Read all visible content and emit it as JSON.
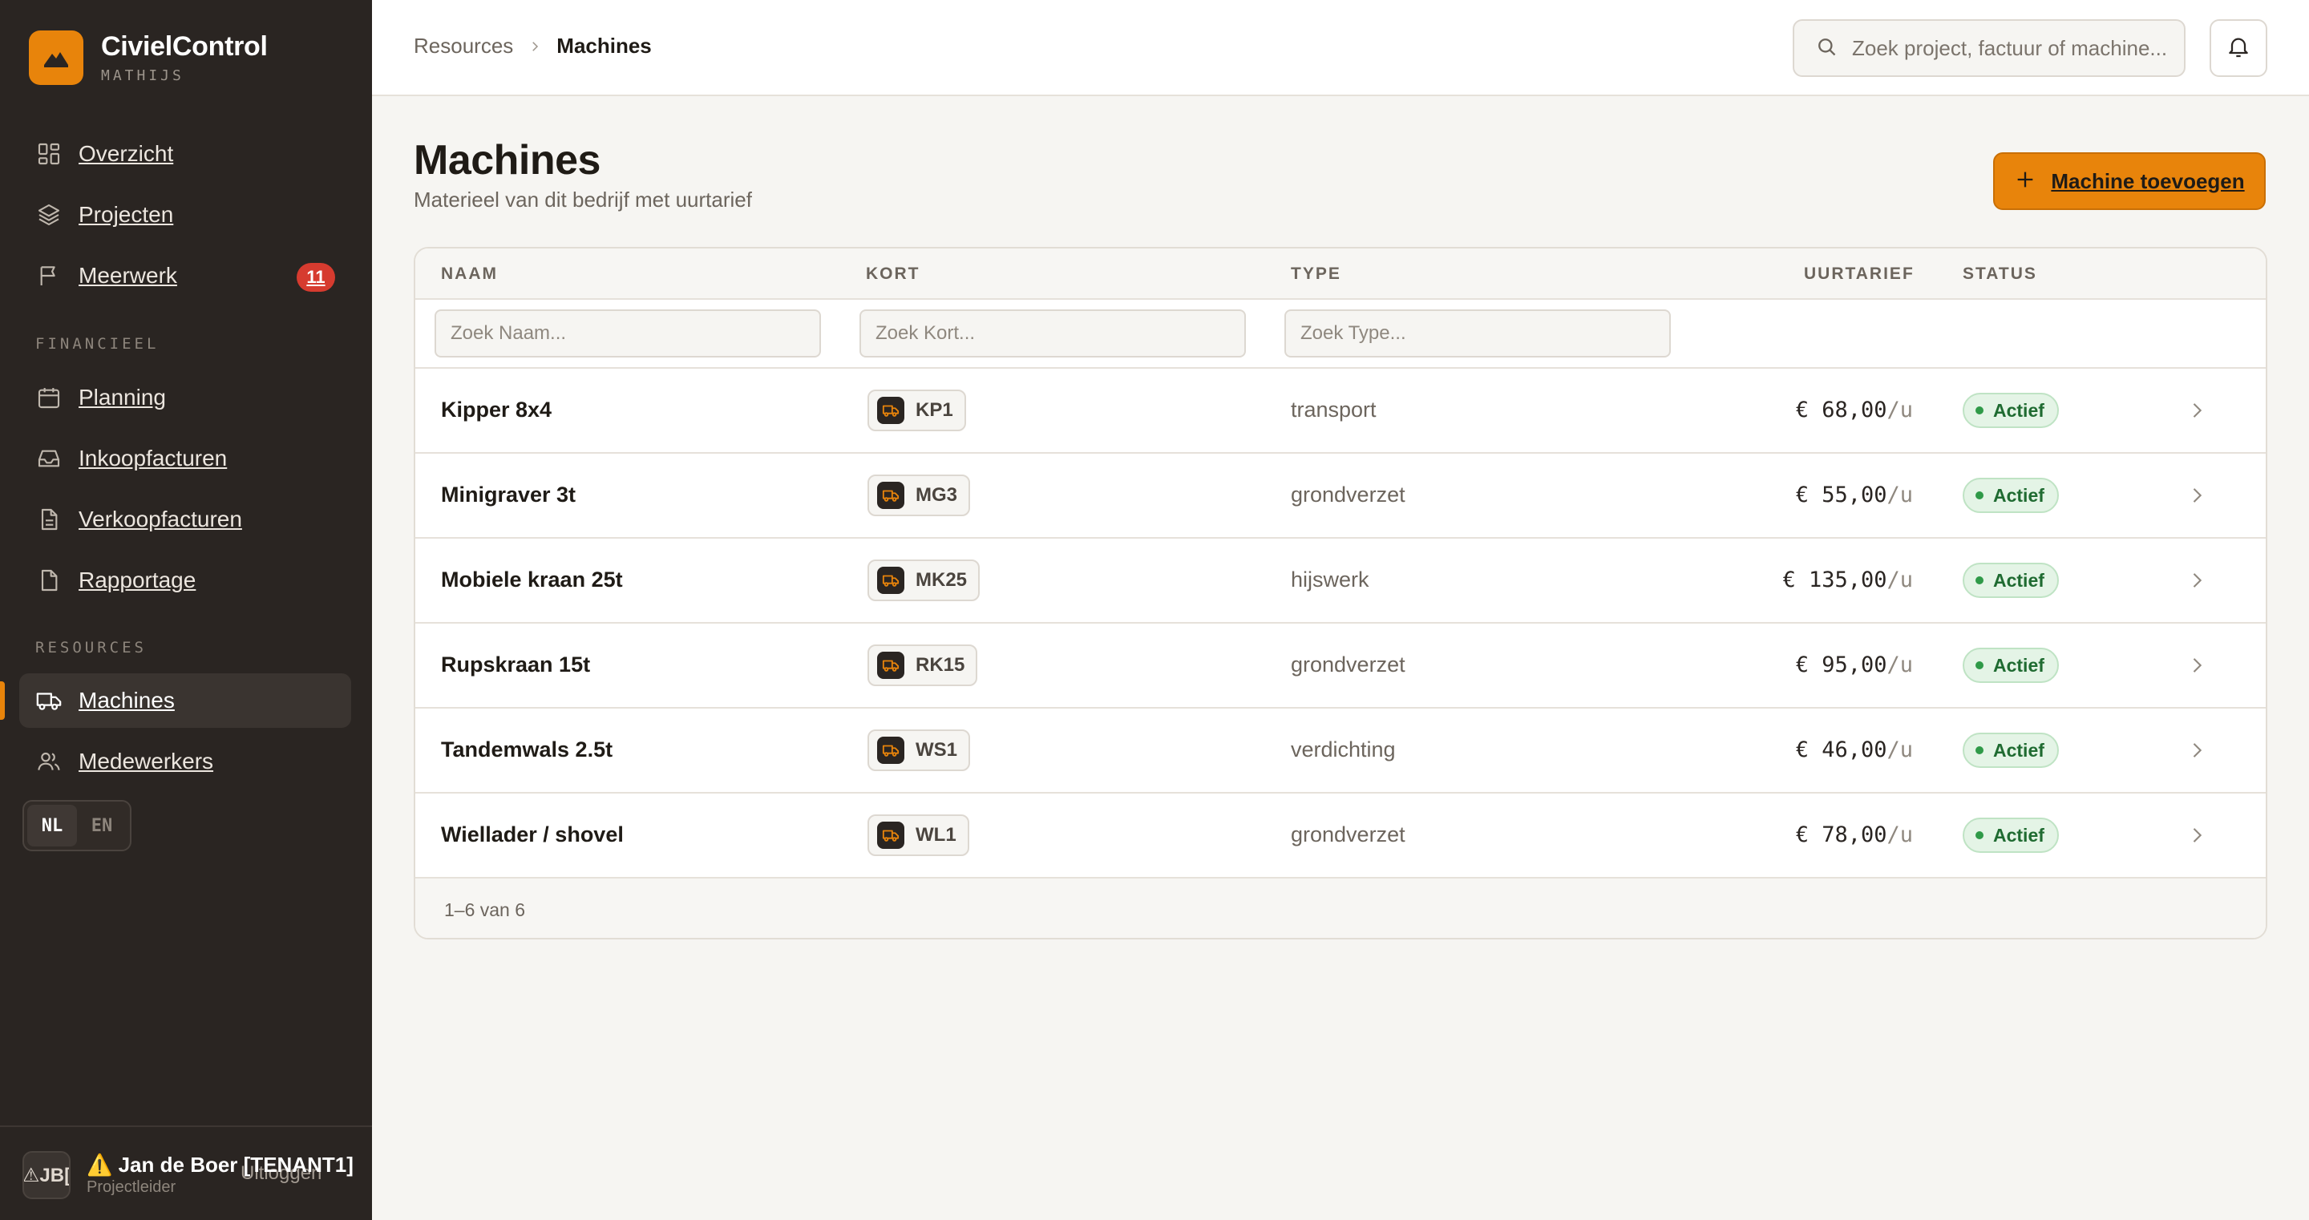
{
  "brand": {
    "name": "CivielControl",
    "tenant": "MATHIJS"
  },
  "nav": {
    "main": [
      {
        "label": "Overzicht",
        "icon": "dashboard-icon"
      },
      {
        "label": "Projecten",
        "icon": "layers-icon"
      },
      {
        "label": "Meerwerk",
        "icon": "flag-icon",
        "badge": "11"
      }
    ],
    "financial_heading": "FINANCIEEL",
    "financial": [
      {
        "label": "Planning",
        "icon": "calendar-icon"
      },
      {
        "label": "Inkoopfacturen",
        "icon": "inbox-icon"
      },
      {
        "label": "Verkoopfacturen",
        "icon": "document-icon"
      },
      {
        "label": "Rapportage",
        "icon": "file-icon"
      }
    ],
    "resources_heading": "RESOURCES",
    "resources": [
      {
        "label": "Machines",
        "icon": "truck-icon",
        "active": true
      },
      {
        "label": "Medewerkers",
        "icon": "users-icon"
      }
    ]
  },
  "lang": {
    "nl": "NL",
    "en": "EN",
    "selected": "NL"
  },
  "user": {
    "avatar": "⚠JB[",
    "name": "⚠️ Jan de Boer [TENANT1]",
    "role": "Projectleider",
    "logout": "Uitloggen"
  },
  "topbar": {
    "breadcrumb_parent": "Resources",
    "breadcrumb_current": "Machines",
    "search_placeholder": "Zoek project, factuur of machine..."
  },
  "page": {
    "title": "Machines",
    "subtitle": "Materieel van dit bedrijf met uurtarief",
    "add_button": "Machine toevoegen"
  },
  "table": {
    "columns": {
      "name": "NAAM",
      "short": "KORT",
      "type": "TYPE",
      "rate": "UURTARIEF",
      "status": "STATUS"
    },
    "filters": {
      "name": "Zoek Naam...",
      "short": "Zoek Kort...",
      "type": "Zoek Type..."
    },
    "rows": [
      {
        "name": "Kipper 8x4",
        "short": "KP1",
        "type": "transport",
        "rate": "€ 68,00",
        "unit": "/u",
        "status": "Actief"
      },
      {
        "name": "Minigraver 3t",
        "short": "MG3",
        "type": "grondverzet",
        "rate": "€ 55,00",
        "unit": "/u",
        "status": "Actief"
      },
      {
        "name": "Mobiele kraan 25t",
        "short": "MK25",
        "type": "hijswerk",
        "rate": "€ 135,00",
        "unit": "/u",
        "status": "Actief"
      },
      {
        "name": "Rupskraan 15t",
        "short": "RK15",
        "type": "grondverzet",
        "rate": "€ 95,00",
        "unit": "/u",
        "status": "Actief"
      },
      {
        "name": "Tandemwals 2.5t",
        "short": "WS1",
        "type": "verdichting",
        "rate": "€ 46,00",
        "unit": "/u",
        "status": "Actief"
      },
      {
        "name": "Wiellader / shovel",
        "short": "WL1",
        "type": "grondverzet",
        "rate": "€ 78,00",
        "unit": "/u",
        "status": "Actief"
      }
    ],
    "pagination": "1–6 van 6"
  },
  "colors": {
    "accent": "#e8840b",
    "sidebar": "#2a2522",
    "badge": "#d63b2f",
    "status_ok": "#2f9a48"
  }
}
